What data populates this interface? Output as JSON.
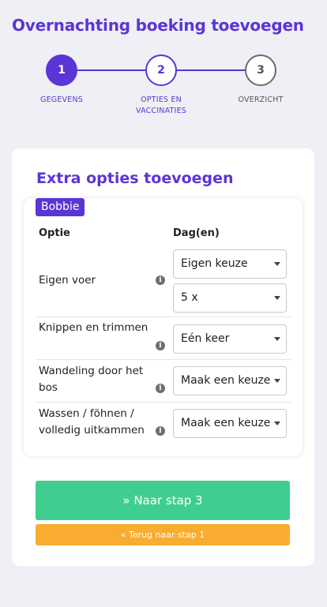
{
  "page": {
    "title": "Overnachting boeking toevoegen"
  },
  "stepper": {
    "steps": [
      {
        "number": "1",
        "label": "GEGEVENS",
        "state": "active"
      },
      {
        "number": "2",
        "label": "OPTIES EN VACCINATIES",
        "state": "current"
      },
      {
        "number": "3",
        "label": "OVERZICHT",
        "state": "upcoming"
      }
    ],
    "active_color": "#5b35d5"
  },
  "section": {
    "title": "Extra opties toevoegen",
    "pet_name": "Bobbie",
    "col_option": "Optie",
    "col_days": "Dag(en)"
  },
  "options": [
    {
      "label": "Eigen voer",
      "icon": "info-icon",
      "selects": [
        "Eigen keuze",
        "5 x"
      ]
    },
    {
      "label": "Knippen en trimmen",
      "icon": "info-icon",
      "selects": [
        "Eén keer"
      ]
    },
    {
      "label": "Wandeling door het bos",
      "icon": "info-icon",
      "selects": [
        "Maak een keuze"
      ]
    },
    {
      "label": "Wassen / föhnen / volledig uitkammen",
      "icon": "info-icon",
      "selects": [
        "Maak een keuze"
      ]
    }
  ],
  "actions": {
    "next_label": "» Naar stap 3",
    "back_label": "« Terug naar stap 1",
    "next_color": "#3fce8f",
    "back_color": "#f8ac30"
  }
}
